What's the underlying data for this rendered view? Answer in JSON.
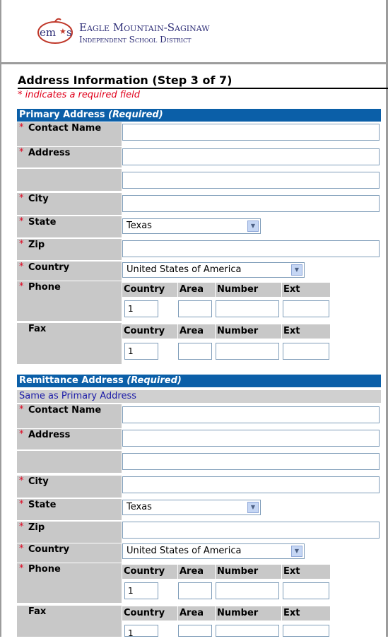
{
  "header": {
    "district_line1": "Eagle Mountain-Saginaw",
    "district_line2": "Independent School District",
    "logo_text": "em s"
  },
  "page_title": "Address Information (Step 3 of 7)",
  "required_note": "* indicates a required field",
  "primary": {
    "title": "Primary Address",
    "title_suffix": "(Required)",
    "contact_label": "Contact Name",
    "address_label": "Address",
    "city_label": "City",
    "state_label": "State",
    "state_value": "Texas",
    "zip_label": "Zip",
    "country_label": "Country",
    "country_value": "United States of America",
    "phone_label": "Phone",
    "fax_label": "Fax",
    "col_country": "Country",
    "col_area": "Area",
    "col_number": "Number",
    "col_ext": "Ext",
    "phone_country_value": "1",
    "fax_country_value": "1"
  },
  "remittance": {
    "title": "Remittance Address",
    "title_suffix": "(Required)",
    "same_as_link": "Same as Primary Address",
    "contact_label": "Contact Name",
    "address_label": "Address",
    "city_label": "City",
    "state_label": "State",
    "state_value": "Texas",
    "zip_label": "Zip",
    "country_label": "Country",
    "country_value": "United States of America",
    "phone_label": "Phone",
    "fax_label": "Fax",
    "col_country": "Country",
    "col_area": "Area",
    "col_number": "Number",
    "col_ext": "Ext",
    "phone_country_value": "1",
    "fax_country_value": "1"
  },
  "required_star": "*",
  "dropdown_glyph": "▼"
}
